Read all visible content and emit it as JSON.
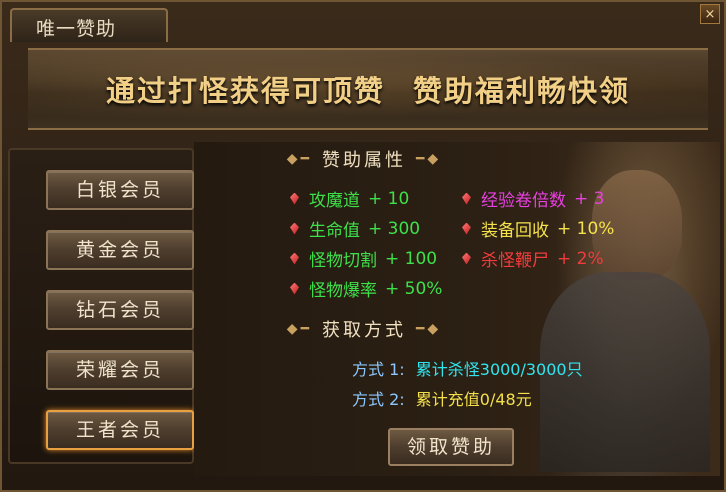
{
  "window": {
    "title": "唯一赞助",
    "close_label": "×"
  },
  "banner": {
    "left": "通过打怪获得可顶赞",
    "right": "赞助福利畅快领"
  },
  "sidebar": {
    "items": [
      {
        "label": "白银会员"
      },
      {
        "label": "黄金会员"
      },
      {
        "label": "钻石会员"
      },
      {
        "label": "荣耀会员"
      },
      {
        "label": "王者会员"
      }
    ],
    "active": "王者会员"
  },
  "attributes": {
    "title": "赞助属性",
    "items": [
      {
        "label": "攻魔道",
        "value": "+ 10",
        "color": "#3ee04a"
      },
      {
        "label": "经验卷倍数",
        "value": "+ 3",
        "color": "#e840e0"
      },
      {
        "label": "生命值",
        "value": "+ 300",
        "color": "#3ee04a"
      },
      {
        "label": "装备回收",
        "value": "+ 10%",
        "color": "#f4e24a"
      },
      {
        "label": "怪物切割",
        "value": "+ 100",
        "color": "#3ee04a"
      },
      {
        "label": "杀怪鞭尸",
        "value": "+ 2%",
        "color": "#f03c3c"
      },
      {
        "label": "怪物爆率",
        "value": "+ 50%",
        "color": "#3ee04a"
      }
    ]
  },
  "methods": {
    "title": "获取方式",
    "items": [
      {
        "label": "方式 1:",
        "value": "累计杀怪3000/3000只",
        "color": "#2ee6f0"
      },
      {
        "label": "方式 2:",
        "value": "累计充值0/48元",
        "color": "#f4e04a"
      }
    ]
  },
  "actions": {
    "claim_label": "领取赞助"
  }
}
